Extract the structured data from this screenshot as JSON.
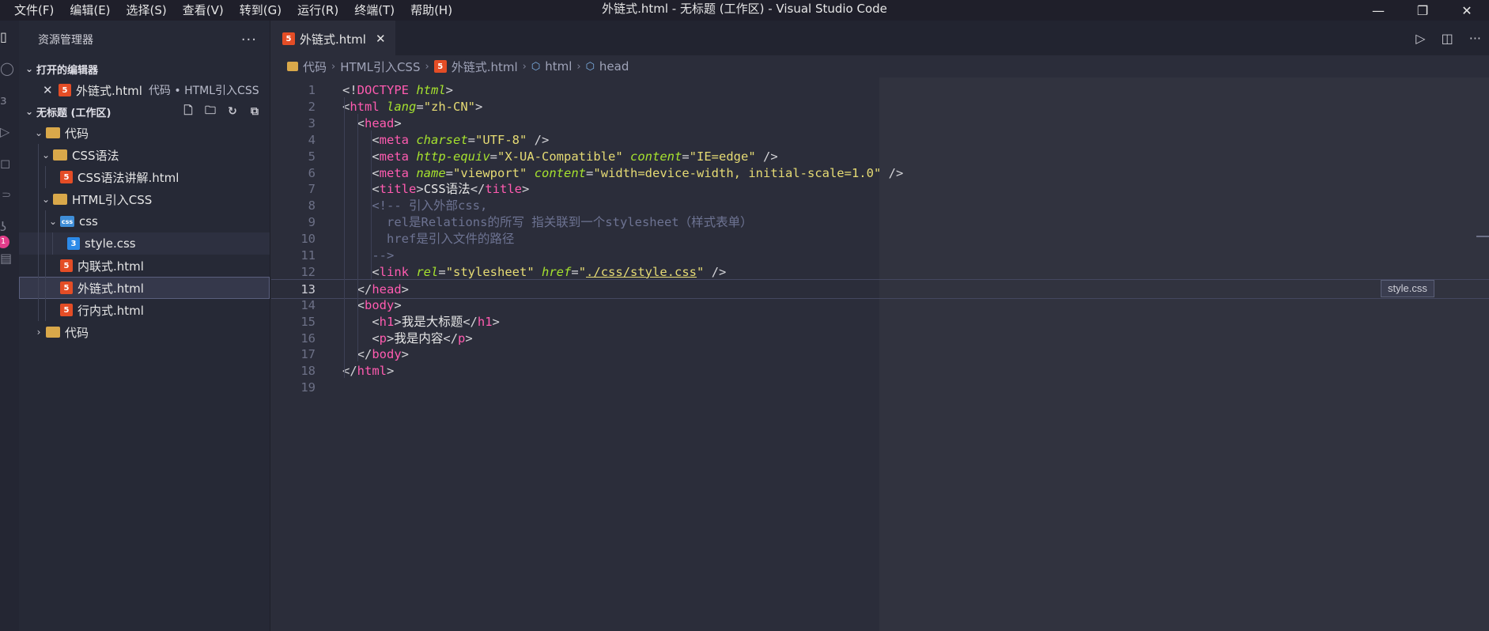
{
  "window": {
    "title": "外链式.html - 无标题 (工作区) - Visual Studio Code",
    "menu": [
      "文件(F)",
      "编辑(E)",
      "选择(S)",
      "查看(V)",
      "转到(G)",
      "运行(R)",
      "终端(T)",
      "帮助(H)"
    ],
    "controls": {
      "minimize": "—",
      "restore": "❐",
      "close": "✕"
    }
  },
  "activity": {
    "badge": "1"
  },
  "sidebar": {
    "title": "资源管理器",
    "more": "···",
    "open_editors": {
      "label": "打开的编辑器",
      "items": [
        {
          "name": "外链式.html",
          "desc": "代码 • HTML引入CSS"
        }
      ]
    },
    "workspace": {
      "label": "无标题 (工作区)",
      "tree": [
        {
          "label": "代码",
          "type": "folder",
          "expanded": true,
          "depth": 0
        },
        {
          "label": "CSS语法",
          "type": "folder",
          "expanded": true,
          "depth": 1
        },
        {
          "label": "CSS语法讲解.html",
          "type": "html",
          "depth": 2
        },
        {
          "label": "HTML引入CSS",
          "type": "folder",
          "expanded": true,
          "depth": 1
        },
        {
          "label": "css",
          "type": "folder-css",
          "expanded": true,
          "depth": 2
        },
        {
          "label": "style.css",
          "type": "css",
          "depth": 3
        },
        {
          "label": "内联式.html",
          "type": "html",
          "depth": 2
        },
        {
          "label": "外链式.html",
          "type": "html",
          "depth": 2
        },
        {
          "label": "行内式.html",
          "type": "html",
          "depth": 2
        },
        {
          "label": "代码",
          "type": "folder",
          "expanded": false,
          "depth": 0
        }
      ]
    }
  },
  "editor": {
    "tab": {
      "label": "外链式.html"
    },
    "breadcrumb": [
      "代码",
      "HTML引入CSS",
      "外链式.html",
      "html",
      "head"
    ],
    "current_line": 13,
    "lines": [
      {
        "n": "1",
        "tokens": [
          [
            "p",
            "<!"
          ],
          [
            "k",
            "DOCTYPE"
          ],
          [
            "p",
            " "
          ],
          [
            "i",
            "html"
          ],
          [
            "p",
            ">"
          ]
        ]
      },
      {
        "n": "2",
        "tokens": [
          [
            "p",
            "<"
          ],
          [
            "t",
            "html"
          ],
          [
            "p",
            " "
          ],
          [
            "a",
            "lang"
          ],
          [
            "p",
            "="
          ],
          [
            "s",
            "\"zh-CN\""
          ],
          [
            "p",
            ">"
          ]
        ]
      },
      {
        "n": "3",
        "tokens": [
          [
            "p",
            "  <"
          ],
          [
            "t",
            "head"
          ],
          [
            "p",
            ">"
          ]
        ]
      },
      {
        "n": "4",
        "tokens": [
          [
            "p",
            "    <"
          ],
          [
            "t",
            "meta"
          ],
          [
            "p",
            " "
          ],
          [
            "a",
            "charset"
          ],
          [
            "p",
            "="
          ],
          [
            "s",
            "\"UTF-8\""
          ],
          [
            "p",
            " />"
          ]
        ]
      },
      {
        "n": "5",
        "tokens": [
          [
            "p",
            "    <"
          ],
          [
            "t",
            "meta"
          ],
          [
            "p",
            " "
          ],
          [
            "a",
            "http-equiv"
          ],
          [
            "p",
            "="
          ],
          [
            "s",
            "\"X-UA-Compatible\""
          ],
          [
            "p",
            " "
          ],
          [
            "a",
            "content"
          ],
          [
            "p",
            "="
          ],
          [
            "s",
            "\"IE=edge\""
          ],
          [
            "p",
            " />"
          ]
        ]
      },
      {
        "n": "6",
        "tokens": [
          [
            "p",
            "    <"
          ],
          [
            "t",
            "meta"
          ],
          [
            "p",
            " "
          ],
          [
            "a",
            "name"
          ],
          [
            "p",
            "="
          ],
          [
            "s",
            "\"viewport\""
          ],
          [
            "p",
            " "
          ],
          [
            "a",
            "content"
          ],
          [
            "p",
            "="
          ],
          [
            "s",
            "\"width=device-width, initial-scale=1.0\""
          ],
          [
            "p",
            " />"
          ]
        ]
      },
      {
        "n": "7",
        "tokens": [
          [
            "p",
            "    <"
          ],
          [
            "t",
            "title"
          ],
          [
            "p",
            ">"
          ],
          [
            "x",
            "CSS语法"
          ],
          [
            "p",
            "</"
          ],
          [
            "t",
            "title"
          ],
          [
            "p",
            ">"
          ]
        ]
      },
      {
        "n": "8",
        "tokens": [
          [
            "c",
            "    <!-- 引入外部css,"
          ]
        ]
      },
      {
        "n": "9",
        "tokens": [
          [
            "c",
            "      rel是Relations的所写 指关联到一个stylesheet（样式表单）"
          ]
        ]
      },
      {
        "n": "10",
        "tokens": [
          [
            "c",
            "      href是引入文件的路径"
          ]
        ]
      },
      {
        "n": "11",
        "tokens": [
          [
            "c",
            "    -->"
          ]
        ]
      },
      {
        "n": "12",
        "tokens": [
          [
            "p",
            "    <"
          ],
          [
            "t",
            "link"
          ],
          [
            "p",
            " "
          ],
          [
            "a",
            "rel"
          ],
          [
            "p",
            "="
          ],
          [
            "s",
            "\"stylesheet\""
          ],
          [
            "p",
            " "
          ],
          [
            "a",
            "href"
          ],
          [
            "p",
            "="
          ],
          [
            "s",
            "\""
          ],
          [
            "u",
            "./css/style.css"
          ],
          [
            "s",
            "\""
          ],
          [
            "p",
            " />"
          ]
        ]
      },
      {
        "n": "13",
        "tokens": [
          [
            "p",
            "  </"
          ],
          [
            "t",
            "head"
          ],
          [
            "p",
            ">"
          ]
        ]
      },
      {
        "n": "14",
        "tokens": [
          [
            "p",
            "  <"
          ],
          [
            "t",
            "body"
          ],
          [
            "p",
            ">"
          ]
        ]
      },
      {
        "n": "15",
        "tokens": [
          [
            "p",
            "    <"
          ],
          [
            "t",
            "h1"
          ],
          [
            "p",
            ">"
          ],
          [
            "x",
            "我是大标题"
          ],
          [
            "p",
            "</"
          ],
          [
            "t",
            "h1"
          ],
          [
            "p",
            ">"
          ]
        ]
      },
      {
        "n": "16",
        "tokens": [
          [
            "p",
            "    <"
          ],
          [
            "t",
            "p"
          ],
          [
            "p",
            ">"
          ],
          [
            "x",
            "我是内容"
          ],
          [
            "p",
            "</"
          ],
          [
            "t",
            "p"
          ],
          [
            "p",
            ">"
          ]
        ]
      },
      {
        "n": "17",
        "tokens": [
          [
            "p",
            "  </"
          ],
          [
            "t",
            "body"
          ],
          [
            "p",
            ">"
          ]
        ]
      },
      {
        "n": "18",
        "tokens": [
          [
            "p",
            "</"
          ],
          [
            "t",
            "html"
          ],
          [
            "p",
            ">"
          ]
        ]
      },
      {
        "n": "19",
        "tokens": []
      }
    ],
    "hover_label": "style.css"
  }
}
